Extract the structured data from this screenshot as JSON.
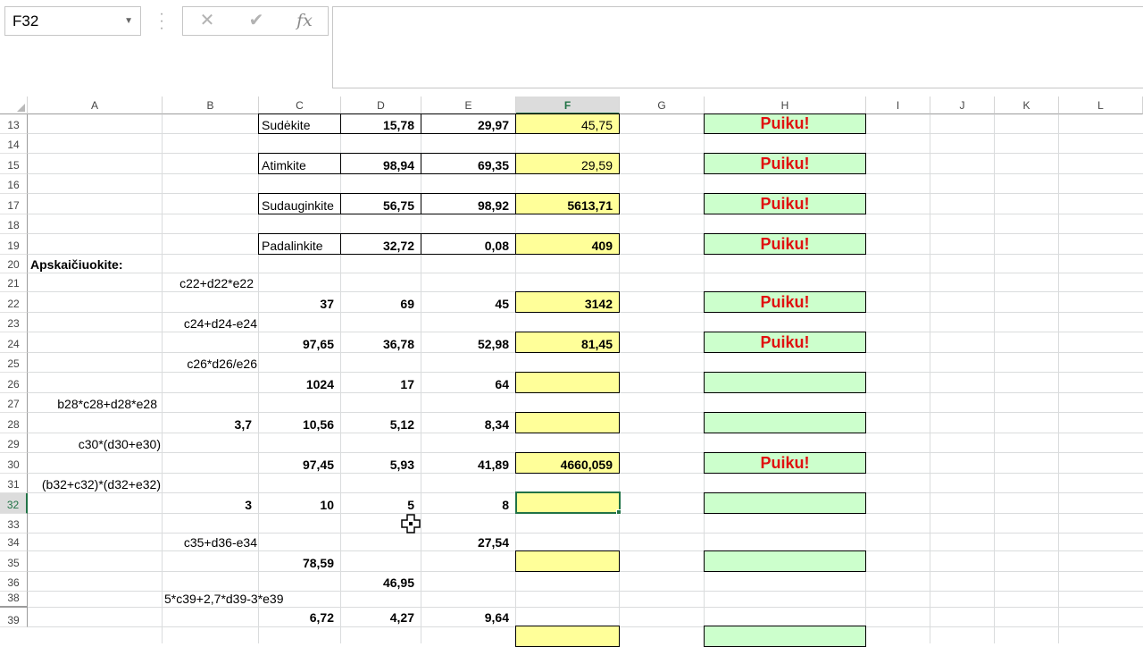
{
  "formula_bar": {
    "name_box": "F32",
    "cancel_icon": "✕",
    "enter_icon": "✔",
    "fx_label": "fx",
    "formula": ""
  },
  "columns": [
    "A",
    "B",
    "C",
    "D",
    "E",
    "F",
    "G",
    "H",
    "I",
    "J",
    "K",
    "L"
  ],
  "selected_column": "F",
  "rows": [
    "13",
    "14",
    "15",
    "16",
    "17",
    "18",
    "19",
    "20",
    "21",
    "22",
    "23",
    "24",
    "25",
    "26",
    "27",
    "28",
    "29",
    "30",
    "31",
    "32",
    "33",
    "34",
    "35",
    "36",
    "38",
    "39"
  ],
  "selected_row": "32",
  "cells": {
    "c13": "Sudėkite",
    "d13": "15,78",
    "e13": "29,97",
    "f13": "45,75",
    "h13": "Puiku!",
    "c15": "Atimkite",
    "d15": "98,94",
    "e15": "69,35",
    "f15": "29,59",
    "h15": "Puiku!",
    "c17": "Sudauginkite",
    "d17": "56,75",
    "e17": "98,92",
    "f17": "5613,71",
    "h17": "Puiku!",
    "c19": "Padalinkite",
    "d19": "32,72",
    "e19": "0,08",
    "f19": "409",
    "h19": "Puiku!",
    "a20": "Apskaičiuokite:",
    "b21": "c22+d22*e22",
    "c22": "37",
    "d22": "69",
    "e22": "45",
    "f22": "3142",
    "h22": "Puiku!",
    "b23": "c24+d24-e24",
    "c24": "97,65",
    "d24": "36,78",
    "e24": "52,98",
    "f24": "81,45",
    "h24": "Puiku!",
    "b25": "c26*d26/e26",
    "c26": "1024",
    "d26": "17",
    "e26": "64",
    "a27": "b28*c28+d28*e28",
    "b28": "3,7",
    "c28": "10,56",
    "d28": "5,12",
    "e28": "8,34",
    "a29": "c30*(d30+e30)",
    "c30": "97,45",
    "d30": "5,93",
    "e30": "41,89",
    "f30": "4660,059",
    "h30": "Puiku!",
    "a31": "(b32+c32)*(d32+e32)",
    "b32": "3",
    "c32": "10",
    "d32": "5",
    "e32": "8",
    "b34": "c35+d36-e34",
    "e34": "27,54",
    "c35": "78,59",
    "d36": "46,95",
    "b38": "5*c39+2,7*d39-3*e39",
    "c39": "6,72",
    "d39": "4,27",
    "e39": "9,64"
  },
  "colors": {
    "accent": "#217346",
    "yellow_fill": "#ffff99",
    "green_fill": "#ccffcc",
    "puiku_text": "#e01010"
  },
  "icons": {
    "cursor": "cell-select-cross-cursor-icon"
  }
}
